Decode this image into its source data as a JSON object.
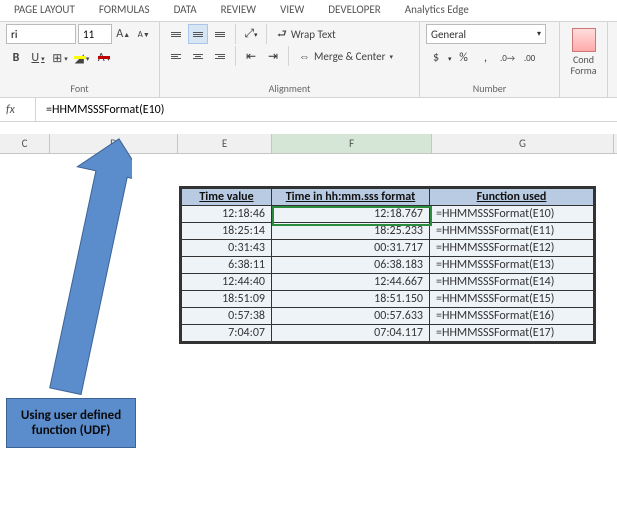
{
  "ribbonTabs": [
    "PAGE LAYOUT",
    "FORMULAS",
    "DATA",
    "REVIEW",
    "VIEW",
    "DEVELOPER",
    "Analytics Edge"
  ],
  "font": {
    "name": "ri",
    "size": "11",
    "increase": "A",
    "decrease": "A"
  },
  "alignment": {
    "wrap": "Wrap Text",
    "merge": "Merge & Center"
  },
  "number": {
    "format": "General",
    "currency": "$",
    "percent": "%",
    "comma": ",",
    "dec1": ".0",
    "dec2": ".00"
  },
  "groupLabels": {
    "font": "Font",
    "alignment": "Alignment",
    "number": "Number"
  },
  "cond": {
    "label": "Cond Forma"
  },
  "formula": {
    "fx": "fx",
    "value": "=HHMMSSSFormat(E10)"
  },
  "cols": {
    "C": "C",
    "D": "D",
    "E": "E",
    "F": "F",
    "G": "G"
  },
  "headers": {
    "e": "Time value",
    "f": "Time in hh:mm.sss format",
    "g": "Function used"
  },
  "rows": [
    {
      "e": "12:18:46",
      "f": "12:18.767",
      "g": "=HHMMSSSFormat(E10)"
    },
    {
      "e": "18:25:14",
      "f": "18:25.233",
      "g": "=HHMMSSSFormat(E11)"
    },
    {
      "e": "0:31:43",
      "f": "00:31.717",
      "g": "=HHMMSSSFormat(E12)"
    },
    {
      "e": "6:38:11",
      "f": "06:38.183",
      "g": "=HHMMSSSFormat(E13)"
    },
    {
      "e": "12:44:40",
      "f": "12:44.667",
      "g": "=HHMMSSSFormat(E14)"
    },
    {
      "e": "18:51:09",
      "f": "18:51.150",
      "g": "=HHMMSSSFormat(E15)"
    },
    {
      "e": "0:57:38",
      "f": "00:57.633",
      "g": "=HHMMSSSFormat(E16)"
    },
    {
      "e": "7:04:07",
      "f": "07:04.117",
      "g": "=HHMMSSSFormat(E17)"
    }
  ],
  "callout": "Using user defined function (UDF)"
}
